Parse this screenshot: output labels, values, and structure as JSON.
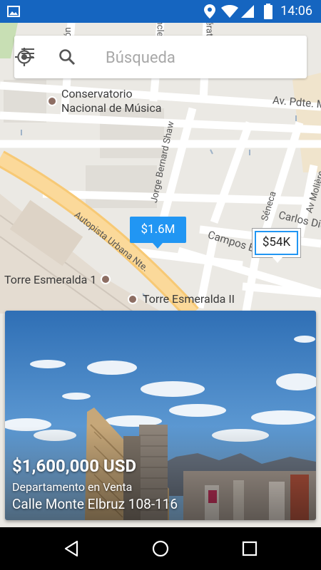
{
  "status_bar": {
    "time": "14:06",
    "icons": [
      "image-icon",
      "location-icon",
      "wifi-icon",
      "signal-icon",
      "battery-icon"
    ]
  },
  "map": {
    "street_labels": [
      "Av. Pdte. Ma",
      "Jorge Bernard Shaw",
      "Autopista Urbana Nte.",
      "Campos Elís",
      "Carlos Dic",
      "Séneca",
      "Av Molière",
      "ncle",
      "érati",
      "ón"
    ],
    "pois": [
      {
        "name_line1": "Conservatorio",
        "name_line2": "Nacional de Música"
      },
      {
        "name_line1": "Torre Esmeralda 1",
        "name_line2": ""
      },
      {
        "name_line1": "Torre Esmeralda II",
        "name_line2": ""
      }
    ],
    "markers": [
      {
        "label": "$1.6M",
        "state": "selected"
      },
      {
        "label": "$54K",
        "state": "default"
      }
    ],
    "accent_color": "#2196f3"
  },
  "search": {
    "placeholder": "Búsqueda",
    "menu_icon": "menu-icon",
    "search_icon": "search-icon",
    "location_icon": "my-location-icon"
  },
  "listing": {
    "price": "$1,600,000 USD",
    "type": "Departamento en Venta",
    "address": "Calle Monte Elbruz 108-116"
  },
  "nav_bar": {
    "icons": [
      "back-icon",
      "home-icon",
      "recents-icon"
    ]
  }
}
